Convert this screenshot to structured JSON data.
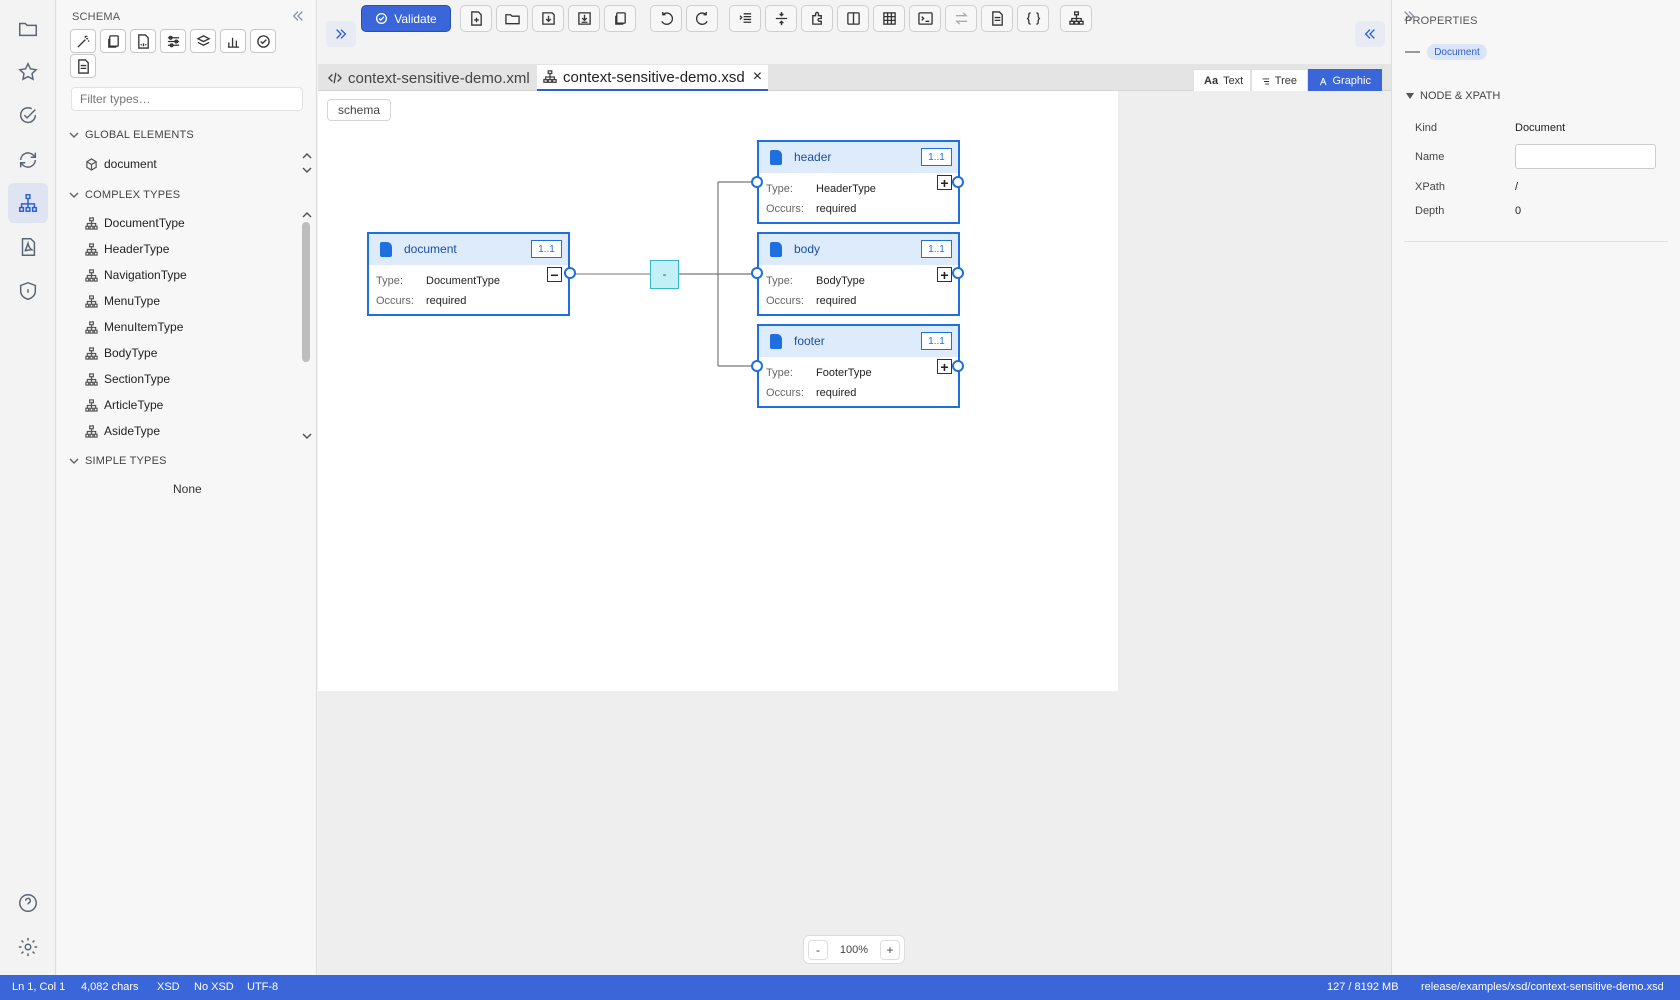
{
  "activity_bar": {
    "items": [
      {
        "name": "folder-icon"
      },
      {
        "name": "star-icon"
      },
      {
        "name": "check-circle-icon"
      },
      {
        "name": "sync-icon"
      },
      {
        "name": "schema-tree-icon"
      },
      {
        "name": "pdf-icon"
      },
      {
        "name": "shield-icon"
      }
    ],
    "bottom": [
      {
        "name": "help-icon"
      },
      {
        "name": "settings-icon"
      }
    ]
  },
  "sidebar": {
    "title": "SCHEMA",
    "filter_placeholder": "Filter types…",
    "global_elements": {
      "header": "GLOBAL ELEMENTS",
      "items": [
        "document"
      ]
    },
    "complex_types": {
      "header": "COMPLEX TYPES",
      "items": [
        "DocumentType",
        "HeaderType",
        "NavigationType",
        "MenuType",
        "MenuItemType",
        "BodyType",
        "SectionType",
        "ArticleType",
        "AsideType"
      ]
    },
    "simple_types": {
      "header": "SIMPLE TYPES",
      "empty": "None"
    }
  },
  "toolbar": {
    "validate_label": "Validate"
  },
  "tabs": [
    {
      "label": "context-sensitive-demo.xml",
      "icon": "code-icon",
      "active": false
    },
    {
      "label": "context-sensitive-demo.xsd",
      "icon": "schema-tree-icon",
      "active": true,
      "close": "×"
    }
  ],
  "view_modes": {
    "text": "Text",
    "text_glyph": "Aa",
    "tree": "Tree",
    "graphic": "Graphic",
    "active": "graphic"
  },
  "diagram": {
    "breadcrumb": "schema",
    "type_label": "Type:",
    "occurs_label": "Occurs:",
    "sequence_label": "-",
    "root": {
      "name": "document",
      "multiplicity": "1..1",
      "type": "DocumentType",
      "occurs": "required",
      "expander": "−"
    },
    "children": [
      {
        "name": "header",
        "multiplicity": "1..1",
        "type": "HeaderType",
        "occurs": "required",
        "expander": "+"
      },
      {
        "name": "body",
        "multiplicity": "1..1",
        "type": "BodyType",
        "occurs": "required",
        "expander": "+"
      },
      {
        "name": "footer",
        "multiplicity": "1..1",
        "type": "FooterType",
        "occurs": "required",
        "expander": "+"
      }
    ]
  },
  "zoom": {
    "minus": "-",
    "value": "100%",
    "plus": "+"
  },
  "properties": {
    "title": "PROPERTIES",
    "kind_badge": "Document",
    "section": "NODE & XPATH",
    "fields": {
      "kind_label": "Kind",
      "kind": "Document",
      "name_label": "Name",
      "name": "",
      "xpath_label": "XPath",
      "xpath": "/",
      "depth_label": "Depth",
      "depth": "0"
    }
  },
  "status_bar": {
    "position": "Ln 1, Col 1",
    "chars": "4,082 chars",
    "lang": "XSD",
    "schema": "No XSD",
    "encoding": "UTF-8",
    "memory": "127 / 8192 MB",
    "path": "release/examples/xsd/context-sensitive-demo.xsd"
  },
  "colors": {
    "accent": "#3a66d9",
    "node_border": "#1e6fe0",
    "node_header": "#deebfb",
    "sequence_fill": "#c3f0f6"
  }
}
